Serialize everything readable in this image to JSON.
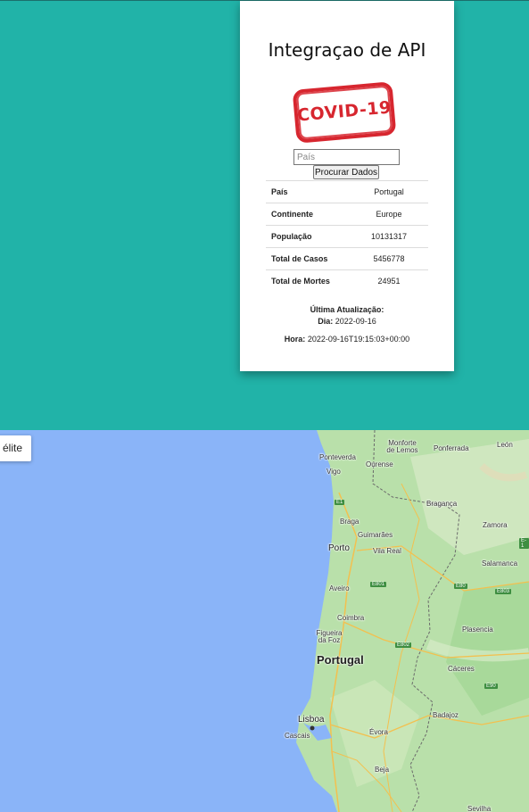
{
  "card": {
    "title": "Integraçao de API",
    "stamp_text": "COVID-19",
    "search": {
      "placeholder": "País",
      "value": ""
    },
    "button_label": "Procurar Dados",
    "rows": [
      {
        "label": "País",
        "value": "Portugal"
      },
      {
        "label": "Continente",
        "value": "Europe"
      },
      {
        "label": "População",
        "value": "10131317"
      },
      {
        "label": "Total de Casos",
        "value": "5456778"
      },
      {
        "label": "Total de Mortes",
        "value": "24951"
      }
    ],
    "update": {
      "title": "Última Atualização:",
      "day_label": "Dia:",
      "day_value": "2022-09-16",
      "hour_label": "Hora:",
      "hour_value": "2022-09-16T19:15:03+00:00"
    }
  },
  "map": {
    "type_button": "élite",
    "country_label": "Portugal",
    "cities": [
      "Ponteverda",
      "Ourense",
      "Monforte de Lemos",
      "Ponferrada",
      "León",
      "Vigo",
      "Bragança",
      "Braga",
      "Guimarães",
      "Zamora",
      "Porto",
      "Vila Real",
      "Salamanca",
      "Aveiro",
      "Coimbra",
      "Figueira da Foz",
      "Plasencia",
      "Cáceres",
      "Lisboa",
      "Cascais",
      "Badajoz",
      "Évora",
      "Beja",
      "Sevilha"
    ],
    "roads": [
      "E1",
      "E801",
      "E80",
      "E803",
      "E802",
      "E90",
      "E-1"
    ]
  },
  "colors": {
    "accent": "#20b2aa",
    "stamp": "#d7262f",
    "water": "#8ab4f8",
    "land": "#b8dfa8"
  }
}
